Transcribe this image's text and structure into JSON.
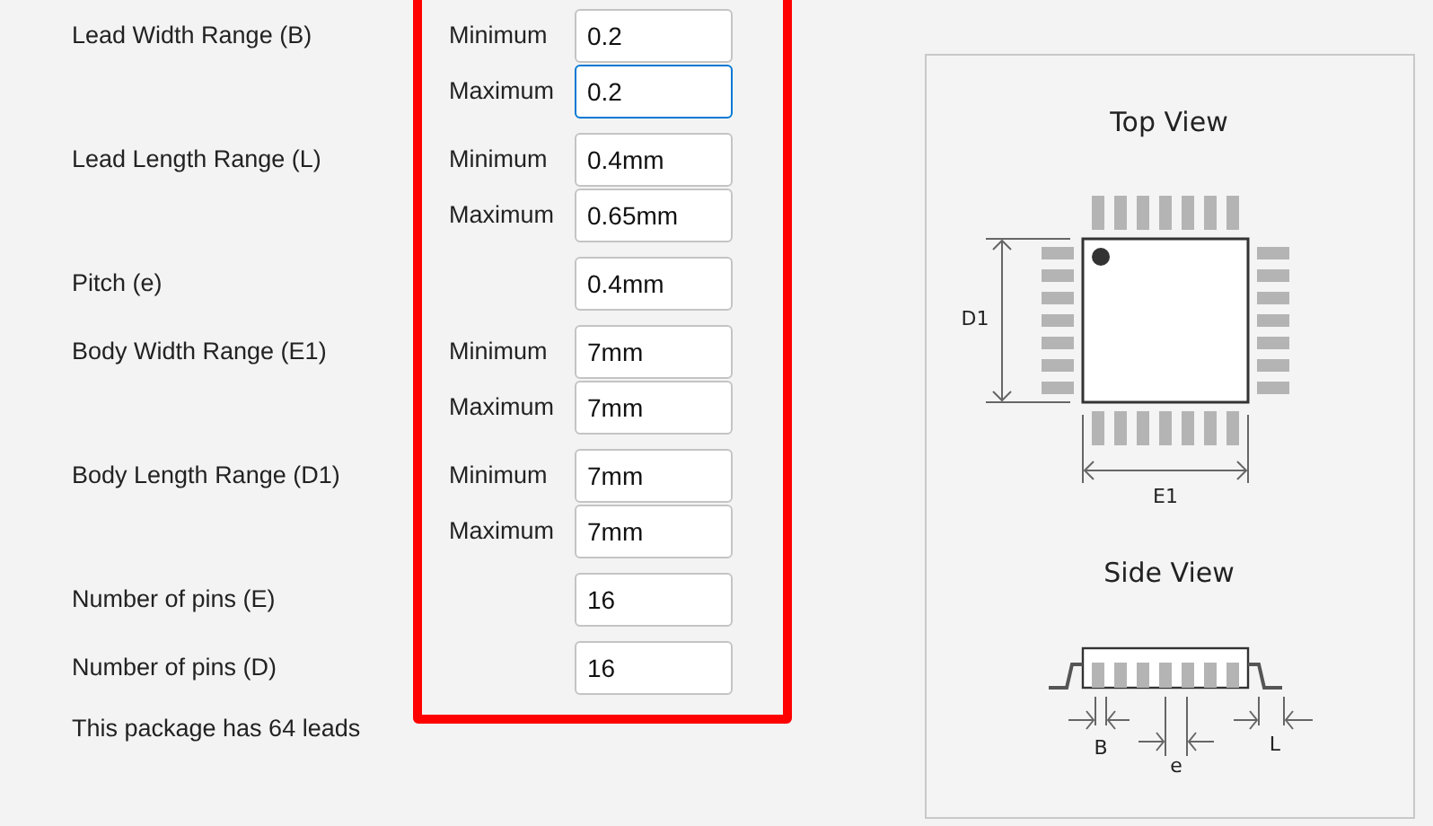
{
  "groups": [
    {
      "label": "Lead Width Range (B)",
      "fields": [
        {
          "caption": "Minimum",
          "value": "0.2",
          "focused": false
        },
        {
          "caption": "Maximum",
          "value": "0.2",
          "focused": true
        }
      ]
    },
    {
      "label": "Lead Length Range (L)",
      "fields": [
        {
          "caption": "Minimum",
          "value": "0.4mm",
          "focused": false
        },
        {
          "caption": "Maximum",
          "value": "0.65mm",
          "focused": false
        }
      ]
    },
    {
      "label": "Pitch (e)",
      "fields": [
        {
          "value": "0.4mm",
          "focused": false
        }
      ]
    },
    {
      "label": "Body Width Range (E1)",
      "fields": [
        {
          "caption": "Minimum",
          "value": "7mm",
          "focused": false
        },
        {
          "caption": "Maximum",
          "value": "7mm",
          "focused": false
        }
      ]
    },
    {
      "label": "Body Length Range (D1)",
      "fields": [
        {
          "caption": "Minimum",
          "value": "7mm",
          "focused": false
        },
        {
          "caption": "Maximum",
          "value": "7mm",
          "focused": false
        }
      ]
    },
    {
      "label": "Number of pins (E)",
      "fields": [
        {
          "value": "16",
          "focused": false
        }
      ]
    },
    {
      "label": "Number of pins (D)",
      "fields": [
        {
          "value": "16",
          "focused": false
        }
      ]
    }
  ],
  "summary": "This package has 64 leads",
  "highlight_frame": {
    "color": "#ff0000"
  },
  "diagram": {
    "top_title": "Top View",
    "side_title": "Side View",
    "d1_label": "D1",
    "e1_label": "E1",
    "b_label": "B",
    "e_label": "e",
    "l_label": "L"
  }
}
